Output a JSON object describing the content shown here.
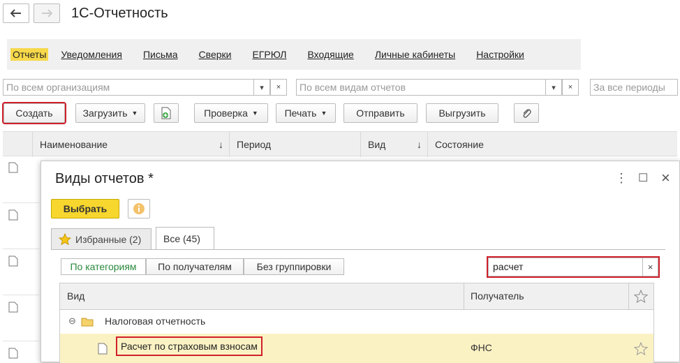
{
  "window": {
    "title": "1С-Отчетность",
    "back_icon": "arrow-left-icon",
    "forward_icon": "arrow-right-icon"
  },
  "sections": [
    "Отчеты",
    "Уведомления",
    "Письма",
    "Сверки",
    "ЕГРЮЛ",
    "Входящие",
    "Личные кабинеты",
    "Настройки"
  ],
  "filters": {
    "organization": "По всем организациям",
    "report_type": "По всем видам отчетов",
    "period": "За все периоды",
    "clear": "×"
  },
  "toolbar": {
    "create": "Создать",
    "load": "Загрузить",
    "check": "Проверка",
    "print": "Печать",
    "send": "Отправить",
    "export": "Выгрузить"
  },
  "table": {
    "columns": [
      "Наименование",
      "Период",
      "Вид",
      "Состояние"
    ],
    "sort_arrow": "↓"
  },
  "dialog": {
    "title": "Виды отчетов *",
    "select": "Выбрать",
    "tabs": [
      "Избранные (2)",
      "Все (45)"
    ],
    "grouping": [
      "По категориям",
      "По получателям",
      "Без группировки"
    ],
    "search": {
      "value": "расчет",
      "clear": "×"
    },
    "columns": {
      "kind": "Вид",
      "recipient": "Получатель"
    },
    "group": {
      "name": "Налоговая отчетность",
      "toggle": "⊖"
    },
    "row": {
      "name": "Расчет по страховым взносам",
      "recipient": "ФНС"
    },
    "menu": "⋮",
    "maximize": "☐",
    "close": "×"
  },
  "colors": {
    "accent_yellow": "#f7d62e",
    "highlight_red": "#d0202a",
    "selected_row": "#fbf2c4"
  }
}
